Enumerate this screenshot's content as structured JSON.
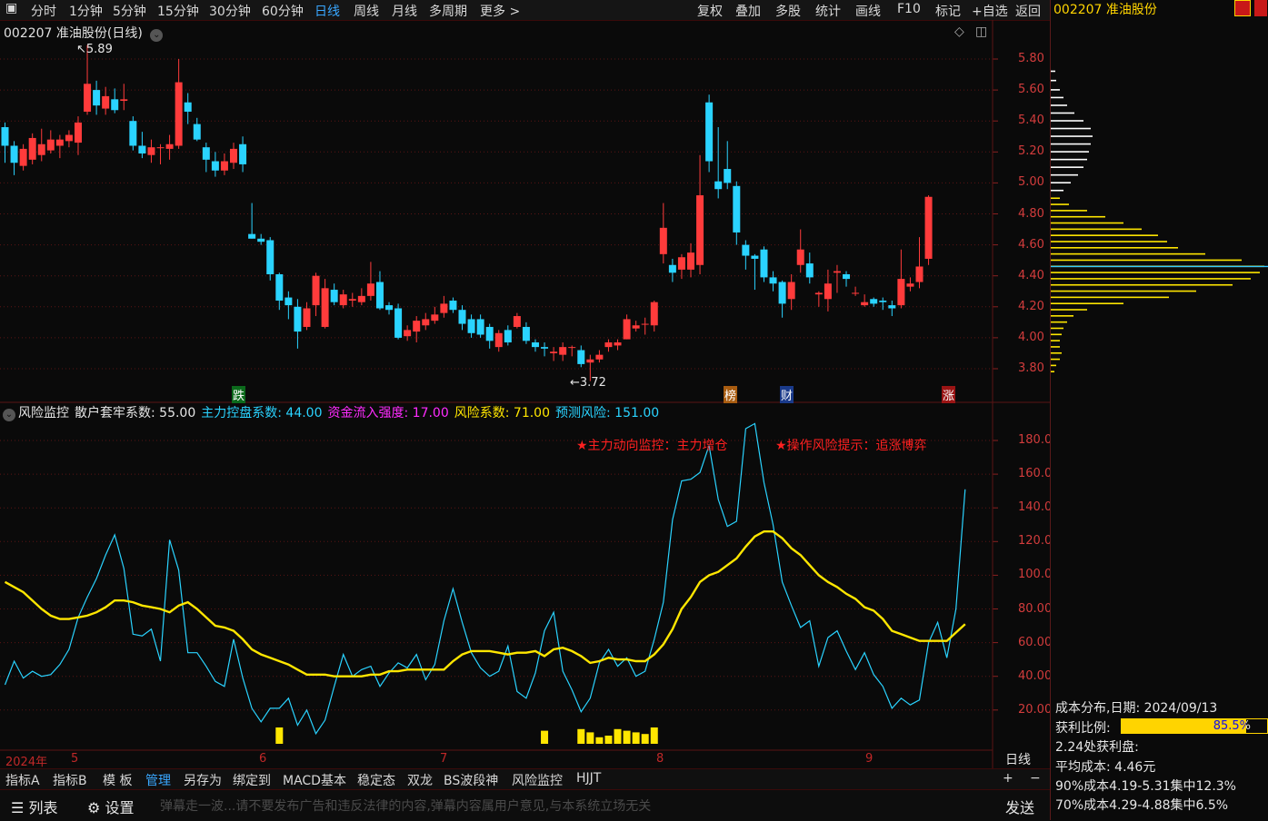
{
  "toolbar": {
    "periods": [
      "分时",
      "1分钟",
      "5分钟",
      "15分钟",
      "30分钟",
      "60分钟",
      "日线",
      "周线",
      "月线",
      "多周期",
      "更多 >"
    ],
    "active_period": "日线",
    "right_buttons": [
      "复权",
      "叠加",
      "多股",
      "统计",
      "画线",
      "F10",
      "标记",
      "+自选",
      "返回"
    ]
  },
  "stock": {
    "title": "002207 准油股份(日线)",
    "code_name": "002207 准油股份"
  },
  "price_axis": [
    "5.80",
    "5.60",
    "5.40",
    "5.20",
    "5.00",
    "4.80",
    "4.60",
    "4.40",
    "4.20",
    "4.00",
    "3.80"
  ],
  "price_annot": {
    "high": "5.89",
    "low": "3.72"
  },
  "event_tags": [
    "跌",
    "榜",
    "财",
    "涨"
  ],
  "indicator": {
    "name": "风险监控",
    "items": [
      {
        "label": "散户套牢系数: 55.00",
        "color": "#e6e6e6"
      },
      {
        "label": "主力控盘系数: 44.00",
        "color": "#2ad3ff"
      },
      {
        "label": "资金流入强度: 17.00",
        "color": "#ff2cff"
      },
      {
        "label": "风险系数: 71.00",
        "color": "#ffe600"
      },
      {
        "label": "预测风险: 151.00",
        "color": "#2ad3ff"
      }
    ],
    "notes": [
      "★主力动向监控：主力增仓",
      "★操作风险提示：追涨博弈"
    ],
    "axis": [
      "180.0",
      "160.0",
      "140.0",
      "120.0",
      "100.0",
      "80.00",
      "60.00",
      "40.00",
      "20.00"
    ]
  },
  "date_axis": {
    "year": "2024年",
    "months": [
      "5",
      "6",
      "7",
      "8",
      "9"
    ],
    "period": "日线"
  },
  "tabs": [
    "指标A",
    "指标B",
    "模 板",
    "管理",
    "另存为",
    "绑定到",
    "MACD基本",
    "稳定态",
    "双龙",
    "BS波段神",
    "风险监控",
    "HJJT"
  ],
  "active_tab": "管理",
  "zoom": {
    "plus": "+",
    "minus": "−"
  },
  "bottom": {
    "list_label": "列表",
    "settings_label": "设置",
    "danmaku_placeholder": "弹幕走一波...请不要发布广告和违反法律的内容,弹幕内容属用户意见,与本系统立场无关",
    "send_label": "发送"
  },
  "cost": {
    "title": "成本分布,日期: 2024/09/13",
    "ratio_label": "获利比例:",
    "ratio_value": "85.5%",
    "ratio_fraction": 0.855,
    "profit_line": "2.24处获利盘:",
    "avg_cost": "平均成本: 4.46元",
    "c90": "90%成本4.19-5.31集中12.3%",
    "c70": "70%成本4.29-4.88集中6.5%"
  },
  "colors": {
    "up": "#ff3b3b",
    "down": "#2ad3ff",
    "ma": "#ffe600",
    "grid": "#5a1414",
    "accent": "#39a7ff"
  },
  "chart_data": {
    "type": "candlestick",
    "candles": [
      [
        5.36,
        5.24,
        5.39,
        5.13
      ],
      [
        5.24,
        5.13,
        5.27,
        5.05
      ],
      [
        5.11,
        5.22,
        5.25,
        5.08
      ],
      [
        5.15,
        5.29,
        5.32,
        5.12
      ],
      [
        5.18,
        5.25,
        5.35,
        5.14
      ],
      [
        5.21,
        5.28,
        5.34,
        5.19
      ],
      [
        5.24,
        5.28,
        5.31,
        5.16
      ],
      [
        5.27,
        5.31,
        5.34,
        5.23
      ],
      [
        5.26,
        5.39,
        5.43,
        5.18
      ],
      [
        5.46,
        5.64,
        5.89,
        5.44
      ],
      [
        5.6,
        5.5,
        5.66,
        5.44
      ],
      [
        5.48,
        5.56,
        5.62,
        5.44
      ],
      [
        5.54,
        5.47,
        5.61,
        5.45
      ],
      [
        5.53,
        5.54,
        5.64,
        5.47
      ],
      [
        5.4,
        5.24,
        5.43,
        5.21
      ],
      [
        5.24,
        5.19,
        5.33,
        5.16
      ],
      [
        5.18,
        5.23,
        5.28,
        5.13
      ],
      [
        5.23,
        5.23,
        5.25,
        5.12
      ],
      [
        5.22,
        5.25,
        5.31,
        5.15
      ],
      [
        5.24,
        5.65,
        5.8,
        5.22
      ],
      [
        5.52,
        5.46,
        5.58,
        5.38
      ],
      [
        5.38,
        5.28,
        5.42,
        5.27
      ],
      [
        5.23,
        5.15,
        5.26,
        5.07
      ],
      [
        5.14,
        5.08,
        5.2,
        5.04
      ],
      [
        5.08,
        5.14,
        5.19,
        5.05
      ],
      [
        5.13,
        5.22,
        5.26,
        5.09
      ],
      [
        5.25,
        5.12,
        5.3,
        5.07
      ],
      [
        4.67,
        4.64,
        4.87,
        4.64
      ],
      [
        4.64,
        4.62,
        4.67,
        4.6
      ],
      [
        4.63,
        4.41,
        4.65,
        4.37
      ],
      [
        4.41,
        4.24,
        4.42,
        4.18
      ],
      [
        4.26,
        4.21,
        4.3,
        4.12
      ],
      [
        4.2,
        4.04,
        4.25,
        3.93
      ],
      [
        4.07,
        4.19,
        4.23,
        4.05
      ],
      [
        4.21,
        4.4,
        4.42,
        4.14
      ],
      [
        4.07,
        4.32,
        4.38,
        4.06
      ],
      [
        4.31,
        4.23,
        4.35,
        4.21
      ],
      [
        4.21,
        4.28,
        4.31,
        4.19
      ],
      [
        4.24,
        4.25,
        4.29,
        4.2
      ],
      [
        4.23,
        4.27,
        4.32,
        4.21
      ],
      [
        4.27,
        4.35,
        4.49,
        4.24
      ],
      [
        4.36,
        4.19,
        4.43,
        4.18
      ],
      [
        4.21,
        4.18,
        4.23,
        4.15
      ],
      [
        4.19,
        4.0,
        4.22,
        3.99
      ],
      [
        4.01,
        4.05,
        4.08,
        3.98
      ],
      [
        4.04,
        4.11,
        4.14,
        3.97
      ],
      [
        4.08,
        4.12,
        4.16,
        4.05
      ],
      [
        4.11,
        4.15,
        4.2,
        4.09
      ],
      [
        4.16,
        4.22,
        4.27,
        4.13
      ],
      [
        4.24,
        4.18,
        4.26,
        4.16
      ],
      [
        4.18,
        4.09,
        4.21,
        4.05
      ],
      [
        4.12,
        4.03,
        4.15,
        4.0
      ],
      [
        4.12,
        4.02,
        4.15,
        4.0
      ],
      [
        4.07,
        3.98,
        4.09,
        3.93
      ],
      [
        3.94,
        4.03,
        4.05,
        3.91
      ],
      [
        4.05,
        3.97,
        4.08,
        3.95
      ],
      [
        4.07,
        4.14,
        4.16,
        4.06
      ],
      [
        4.07,
        3.98,
        4.1,
        3.96
      ],
      [
        3.97,
        3.94,
        3.99,
        3.91
      ],
      [
        3.94,
        3.93,
        3.97,
        3.88
      ],
      [
        3.9,
        3.91,
        3.94,
        3.85
      ],
      [
        3.89,
        3.94,
        3.97,
        3.85
      ],
      [
        3.94,
        3.94,
        3.95,
        3.88
      ],
      [
        3.92,
        3.83,
        3.95,
        3.81
      ],
      [
        3.84,
        3.86,
        3.89,
        3.72
      ],
      [
        3.86,
        3.89,
        3.92,
        3.84
      ],
      [
        3.94,
        3.97,
        3.99,
        3.91
      ],
      [
        3.95,
        3.97,
        3.99,
        3.92
      ],
      [
        3.99,
        4.12,
        4.15,
        3.99
      ],
      [
        4.06,
        4.08,
        4.11,
        4.04
      ],
      [
        4.09,
        4.09,
        4.13,
        4.02
      ],
      [
        4.08,
        4.23,
        4.24,
        4.04
      ],
      [
        4.54,
        4.71,
        4.87,
        4.48
      ],
      [
        4.47,
        4.42,
        4.51,
        4.36
      ],
      [
        4.44,
        4.52,
        4.54,
        4.38
      ],
      [
        4.44,
        4.55,
        4.61,
        4.39
      ],
      [
        4.47,
        4.92,
        5.18,
        4.41
      ],
      [
        5.52,
        5.14,
        5.57,
        5.07
      ],
      [
        5.01,
        4.96,
        5.36,
        4.9
      ],
      [
        5.09,
        5.0,
        5.27,
        4.96
      ],
      [
        4.98,
        4.68,
        5.01,
        4.6
      ],
      [
        4.6,
        4.53,
        4.63,
        4.44
      ],
      [
        4.53,
        4.51,
        4.54,
        4.31
      ],
      [
        4.57,
        4.39,
        4.59,
        4.36
      ],
      [
        4.39,
        4.35,
        4.43,
        4.3
      ],
      [
        4.36,
        4.22,
        4.37,
        4.13
      ],
      [
        4.25,
        4.36,
        4.41,
        4.18
      ],
      [
        4.47,
        4.57,
        4.7,
        4.42
      ],
      [
        4.48,
        4.39,
        4.55,
        4.35
      ],
      [
        4.28,
        4.29,
        4.3,
        4.2
      ],
      [
        4.25,
        4.35,
        4.44,
        4.17
      ],
      [
        4.42,
        4.43,
        4.47,
        4.29
      ],
      [
        4.41,
        4.38,
        4.43,
        4.33
      ],
      [
        4.29,
        4.29,
        4.33,
        4.27
      ],
      [
        4.21,
        4.23,
        4.28,
        4.2
      ],
      [
        4.25,
        4.22,
        4.26,
        4.2
      ],
      [
        4.24,
        4.23,
        4.26,
        4.18
      ],
      [
        4.21,
        4.19,
        4.24,
        4.14
      ],
      [
        4.21,
        4.38,
        4.57,
        4.19
      ],
      [
        4.33,
        4.35,
        4.39,
        4.3
      ],
      [
        4.36,
        4.46,
        4.65,
        4.32
      ],
      [
        4.51,
        4.91,
        4.92,
        4.47
      ]
    ],
    "ylim": [
      3.7,
      5.9
    ],
    "risk_line": [
      35,
      49,
      39,
      43,
      40,
      41,
      47,
      56,
      75,
      87,
      98,
      112,
      124,
      104,
      65,
      64,
      68,
      49,
      121,
      103,
      54,
      54,
      46,
      37,
      34,
      62,
      39,
      21,
      13,
      21,
      21,
      27,
      11,
      20,
      6,
      14,
      34,
      53,
      40,
      44,
      46,
      34,
      42,
      48,
      45,
      53,
      38,
      47,
      73,
      92,
      72,
      54,
      45,
      40,
      43,
      58,
      31,
      27,
      42,
      67,
      78,
      43,
      32,
      19,
      27,
      48,
      56,
      46,
      51,
      40,
      43,
      62,
      84,
      133,
      156,
      157,
      161,
      177,
      145,
      129,
      132,
      187,
      190,
      155,
      130,
      96,
      82,
      69,
      73,
      46,
      63,
      67,
      55,
      44,
      54,
      41,
      34,
      21,
      27,
      23,
      26,
      60,
      72,
      51,
      80,
      151
    ],
    "ma_line": [
      96,
      93,
      90,
      85,
      80,
      76,
      74,
      74,
      75,
      76,
      78,
      81,
      85,
      85,
      84,
      82,
      81,
      80,
      78,
      82,
      84,
      80,
      75,
      70,
      69,
      67,
      62,
      56,
      53,
      51,
      49,
      47,
      44,
      41,
      41,
      41,
      40,
      40,
      40,
      40,
      41,
      41,
      43,
      43,
      44,
      44,
      44,
      44,
      44,
      49,
      53,
      55,
      55,
      55,
      54,
      53,
      54,
      54,
      55,
      52,
      56,
      57,
      55,
      52,
      48,
      49,
      51,
      50,
      50,
      49,
      49,
      53,
      59,
      68,
      80,
      87,
      96,
      100,
      102,
      106,
      110,
      117,
      123,
      126,
      126,
      122,
      116,
      112,
      106,
      100,
      96,
      93,
      89,
      86,
      81,
      79,
      74,
      67,
      65,
      63,
      61,
      61,
      61,
      61,
      66,
      71
    ],
    "signal_bars": [
      {
        "i": 30,
        "h": 1.0
      },
      {
        "i": 59,
        "h": 0.8
      },
      {
        "i": 63,
        "h": 0.9
      },
      {
        "i": 64,
        "h": 0.7
      },
      {
        "i": 65,
        "h": 0.4
      },
      {
        "i": 66,
        "h": 0.5
      },
      {
        "i": 67,
        "h": 0.9
      },
      {
        "i": 68,
        "h": 0.8
      },
      {
        "i": 69,
        "h": 0.7
      },
      {
        "i": 70,
        "h": 0.6
      },
      {
        "i": 71,
        "h": 1.0
      }
    ],
    "cost_profile": [
      {
        "price": 5.72,
        "w": 5
      },
      {
        "price": 5.66,
        "w": 6
      },
      {
        "price": 5.6,
        "w": 10
      },
      {
        "price": 5.55,
        "w": 14
      },
      {
        "price": 5.5,
        "w": 18
      },
      {
        "price": 5.45,
        "w": 26
      },
      {
        "price": 5.4,
        "w": 36
      },
      {
        "price": 5.35,
        "w": 44
      },
      {
        "price": 5.3,
        "w": 46
      },
      {
        "price": 5.25,
        "w": 44
      },
      {
        "price": 5.2,
        "w": 42
      },
      {
        "price": 5.15,
        "w": 40
      },
      {
        "price": 5.1,
        "w": 36
      },
      {
        "price": 5.05,
        "w": 30
      },
      {
        "price": 5.0,
        "w": 22
      },
      {
        "price": 4.95,
        "w": 14
      },
      {
        "price": 4.9,
        "w": 10
      },
      {
        "price": 4.86,
        "w": 20
      },
      {
        "price": 4.82,
        "w": 40
      },
      {
        "price": 4.78,
        "w": 60
      },
      {
        "price": 4.74,
        "w": 80
      },
      {
        "price": 4.7,
        "w": 100
      },
      {
        "price": 4.66,
        "w": 118
      },
      {
        "price": 4.62,
        "w": 128
      },
      {
        "price": 4.58,
        "w": 140
      },
      {
        "price": 4.54,
        "w": 170
      },
      {
        "price": 4.5,
        "w": 210
      },
      {
        "price": 4.46,
        "w": 235
      },
      {
        "price": 4.42,
        "w": 230
      },
      {
        "price": 4.38,
        "w": 220
      },
      {
        "price": 4.34,
        "w": 200
      },
      {
        "price": 4.3,
        "w": 160
      },
      {
        "price": 4.26,
        "w": 130
      },
      {
        "price": 4.22,
        "w": 80
      },
      {
        "price": 4.18,
        "w": 40
      },
      {
        "price": 4.14,
        "w": 25
      },
      {
        "price": 4.1,
        "w": 18
      },
      {
        "price": 4.06,
        "w": 14
      },
      {
        "price": 4.02,
        "w": 12
      },
      {
        "price": 3.98,
        "w": 10
      },
      {
        "price": 3.94,
        "w": 10
      },
      {
        "price": 3.9,
        "w": 12
      },
      {
        "price": 3.86,
        "w": 10
      },
      {
        "price": 3.82,
        "w": 6
      },
      {
        "price": 3.78,
        "w": 4
      }
    ],
    "cost_split_price": 4.91,
    "avg_cost": 4.46
  }
}
